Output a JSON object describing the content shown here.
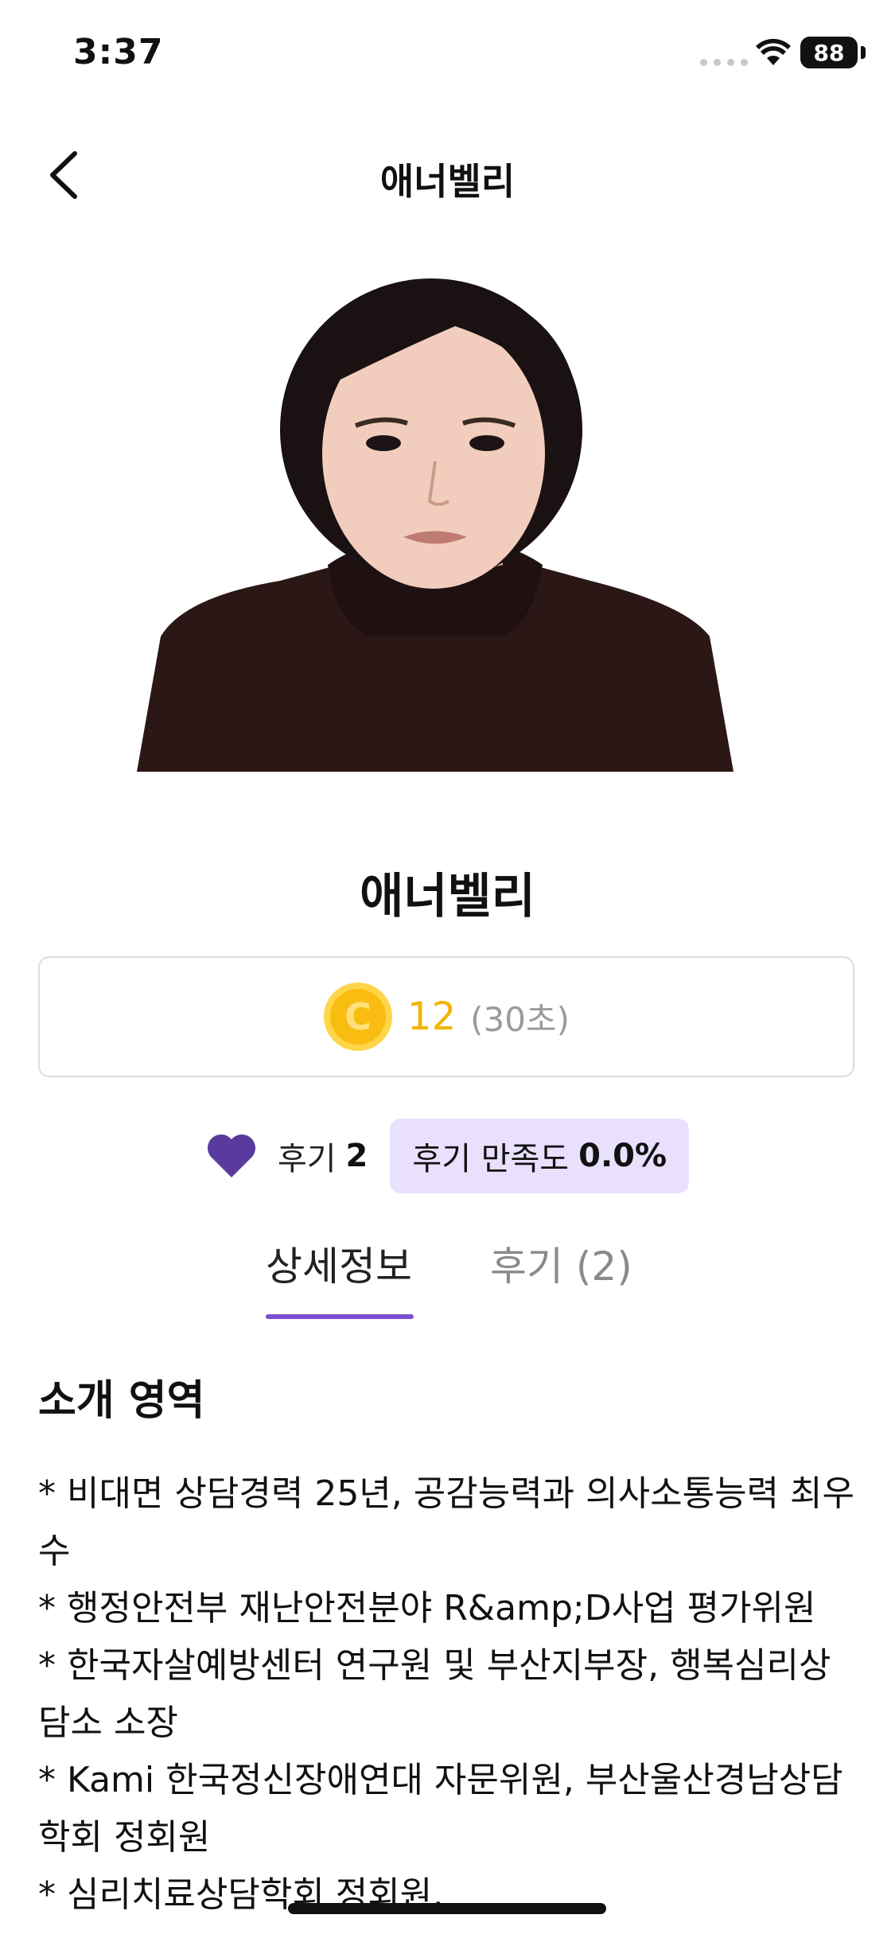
{
  "status_bar": {
    "time": "3:37",
    "battery": "88"
  },
  "nav": {
    "title": "애너벨리"
  },
  "profile": {
    "name": "애너벨리",
    "price": {
      "coin_letter": "C",
      "amount": "12",
      "unit": "(30초)"
    },
    "reviews": {
      "label": "후기",
      "count": "2",
      "satisfaction_label": "후기 만족도",
      "satisfaction_value": "0.0%"
    }
  },
  "tabs": [
    {
      "label": "상세정보",
      "active": true
    },
    {
      "label": "후기 (2)",
      "active": false
    }
  ],
  "intro": {
    "heading": "소개 영역",
    "lines": [
      "* 비대면 상담경력 25년, 공감능력과 의사소통능력 최우수",
      "* 행정안전부 재난안전분야 R&amp;D사업 평가위원",
      "* 한국자살예방센터 연구원 및 부산지부장, 행복심리상담소 소장",
      "* Kami 한국정신장애연대 자문위원, 부산울산경남상담학회 정회원",
      "* 심리치료상담학회 정회원,"
    ]
  },
  "colors": {
    "accent": "#7b4fd2",
    "coin": "#f4b400",
    "badge_bg": "#e9e0fd",
    "heart": "#5b3a9e"
  }
}
